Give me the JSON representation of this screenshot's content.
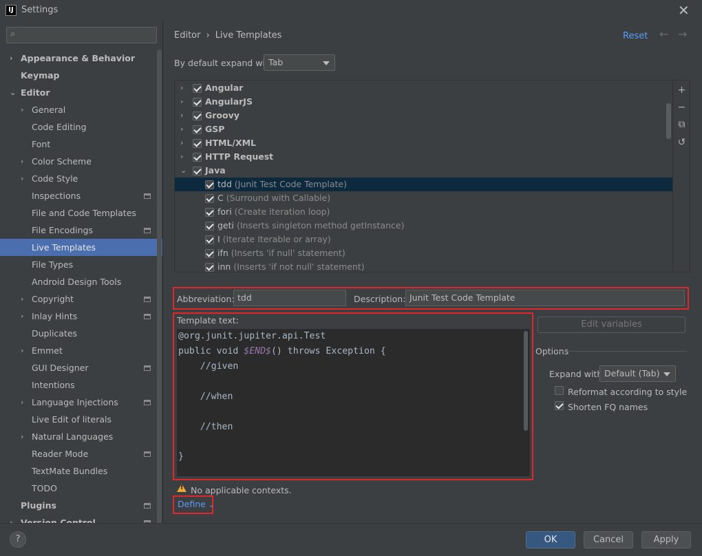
{
  "window": {
    "title": "Settings",
    "logo_text": "IJ"
  },
  "search": {
    "placeholder": "",
    "value": ""
  },
  "sidebar": {
    "items": [
      {
        "label": "Appearance & Behavior",
        "level": 0,
        "chevron": "›",
        "bold": true
      },
      {
        "label": "Keymap",
        "level": 0,
        "chevron": "",
        "bold": true
      },
      {
        "label": "Editor",
        "level": 0,
        "chevron": "⌄",
        "bold": true
      },
      {
        "label": "General",
        "level": 1,
        "chevron": "›"
      },
      {
        "label": "Code Editing",
        "level": 1,
        "chevron": ""
      },
      {
        "label": "Font",
        "level": 1,
        "chevron": ""
      },
      {
        "label": "Color Scheme",
        "level": 1,
        "chevron": "›"
      },
      {
        "label": "Code Style",
        "level": 1,
        "chevron": "›"
      },
      {
        "label": "Inspections",
        "level": 1,
        "chevron": "",
        "project": true
      },
      {
        "label": "File and Code Templates",
        "level": 1,
        "chevron": ""
      },
      {
        "label": "File Encodings",
        "level": 1,
        "chevron": "",
        "project": true
      },
      {
        "label": "Live Templates",
        "level": 1,
        "chevron": "",
        "selected": true
      },
      {
        "label": "File Types",
        "level": 1,
        "chevron": ""
      },
      {
        "label": "Android Design Tools",
        "level": 1,
        "chevron": ""
      },
      {
        "label": "Copyright",
        "level": 1,
        "chevron": "›",
        "project": true
      },
      {
        "label": "Inlay Hints",
        "level": 1,
        "chevron": "›",
        "project": true
      },
      {
        "label": "Duplicates",
        "level": 1,
        "chevron": ""
      },
      {
        "label": "Emmet",
        "level": 1,
        "chevron": "›"
      },
      {
        "label": "GUI Designer",
        "level": 1,
        "chevron": "",
        "project": true
      },
      {
        "label": "Intentions",
        "level": 1,
        "chevron": ""
      },
      {
        "label": "Language Injections",
        "level": 1,
        "chevron": "›",
        "project": true
      },
      {
        "label": "Live Edit of literals",
        "level": 1,
        "chevron": ""
      },
      {
        "label": "Natural Languages",
        "level": 1,
        "chevron": "›"
      },
      {
        "label": "Reader Mode",
        "level": 1,
        "chevron": "",
        "project": true
      },
      {
        "label": "TextMate Bundles",
        "level": 1,
        "chevron": ""
      },
      {
        "label": "TODO",
        "level": 1,
        "chevron": ""
      },
      {
        "label": "Plugins",
        "level": 0,
        "chevron": "",
        "bold": true,
        "project": true
      },
      {
        "label": "Version Control",
        "level": 0,
        "chevron": "›",
        "bold": true,
        "project": true
      }
    ]
  },
  "breadcrumb": {
    "parent": "Editor",
    "separator": "›",
    "current": "Live Templates"
  },
  "header": {
    "reset_label": "Reset",
    "back_icon": "←",
    "forward_icon": "→"
  },
  "expand_default": {
    "label": "By default expand with",
    "value": "Tab"
  },
  "templates": {
    "rows": [
      {
        "name": "Angular",
        "group": true,
        "chevron": "›",
        "checked": true,
        "desc": ""
      },
      {
        "name": "AngularJS",
        "group": true,
        "chevron": "›",
        "checked": true,
        "desc": ""
      },
      {
        "name": "Groovy",
        "group": true,
        "chevron": "›",
        "checked": true,
        "desc": ""
      },
      {
        "name": "GSP",
        "group": true,
        "chevron": "›",
        "checked": true,
        "desc": ""
      },
      {
        "name": "HTML/XML",
        "group": true,
        "chevron": "›",
        "checked": true,
        "desc": ""
      },
      {
        "name": "HTTP Request",
        "group": true,
        "chevron": "›",
        "checked": true,
        "desc": ""
      },
      {
        "name": "Java",
        "group": true,
        "chevron": "⌄",
        "checked": true,
        "desc": ""
      },
      {
        "name": "tdd",
        "group": false,
        "checked": true,
        "desc": "(Junit Test Code Template)",
        "selected": true
      },
      {
        "name": "C",
        "group": false,
        "checked": true,
        "desc": "(Surround with Callable)"
      },
      {
        "name": "fori",
        "group": false,
        "checked": true,
        "desc": "(Create iteration loop)"
      },
      {
        "name": "geti",
        "group": false,
        "checked": true,
        "desc": "(Inserts singleton method getInstance)"
      },
      {
        "name": "I",
        "group": false,
        "checked": true,
        "desc": "(Iterate Iterable or array)"
      },
      {
        "name": "ifn",
        "group": false,
        "checked": true,
        "desc": "(Inserts 'if null' statement)"
      },
      {
        "name": "inn",
        "group": false,
        "checked": true,
        "desc": "(Inserts 'if not null' statement)"
      }
    ],
    "tools": {
      "add_icon": "+",
      "remove_icon": "−",
      "copy_icon": "⧉",
      "restore_icon": "↺"
    }
  },
  "detail": {
    "abbreviation_label": "Abbreviation:",
    "abbreviation_value": "tdd",
    "description_label": "Description:",
    "description_value": "Junit Test Code Template",
    "template_text_label": "Template text:",
    "edit_variables_label": "Edit variables"
  },
  "code": {
    "line1": "@org.junit.jupiter.api.Test",
    "line2_pre": "public void ",
    "line2_var": "$END$",
    "line2_post": "() throws Exception {",
    "line3": "    //given",
    "line4": "    //when",
    "line5": "    //then",
    "line6": "}"
  },
  "options": {
    "title": "Options",
    "expand_with_label": "Expand with",
    "expand_with_value": "Default (Tab)",
    "reformat_label": "Reformat according to style",
    "reformat_checked": false,
    "shorten_label": "Shorten FQ names",
    "shorten_checked": true
  },
  "contexts": {
    "warning_text": "No applicable contexts.",
    "define_label": "Define",
    "define_caret": "⌄"
  },
  "footer": {
    "help": "?",
    "ok": "OK",
    "cancel": "Cancel",
    "apply": "Apply"
  },
  "colors": {
    "accent": "#589df6",
    "selection": "#4b6eaf",
    "highlight": "#e0272c"
  }
}
